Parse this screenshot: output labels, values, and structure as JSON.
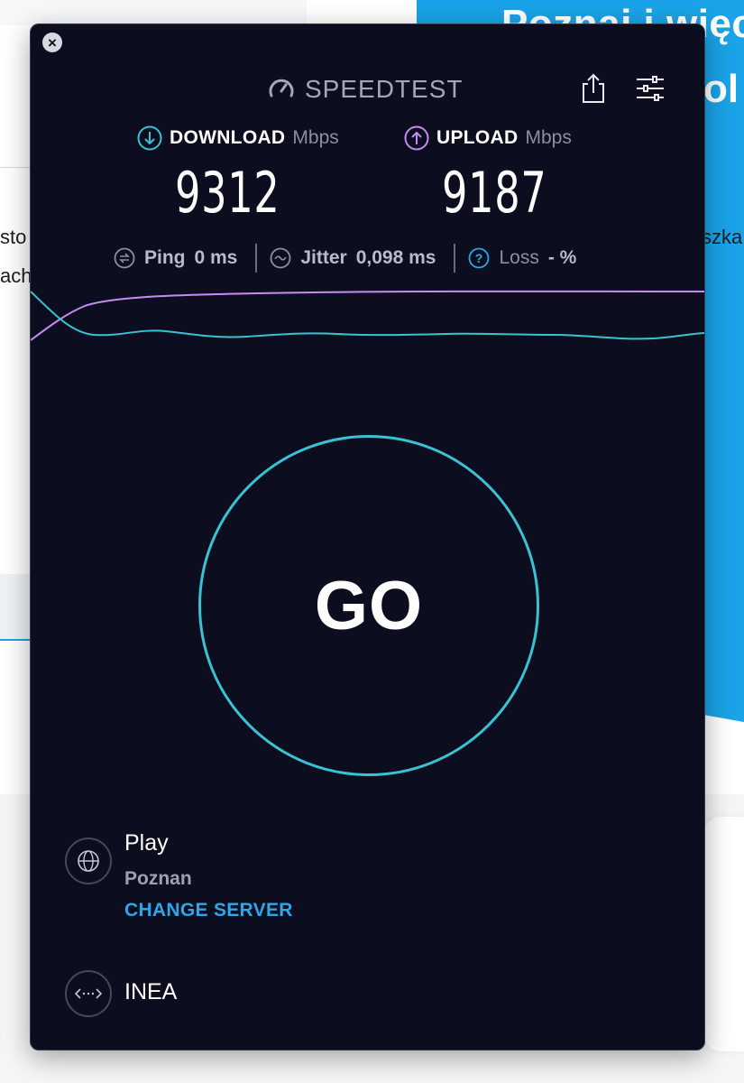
{
  "background_page": {
    "hero_title_line1": "Poznaj i więc",
    "hero_title_line2": "ol",
    "left_text_1": "sto",
    "left_text_2": "ach",
    "right_text_1": "szka",
    "accent_color": "#1aa3e8"
  },
  "window": {
    "close_icon": "close-icon",
    "brand": "SPEEDTEST",
    "share_icon": "share-icon",
    "settings_icon": "settings-sliders-icon"
  },
  "download": {
    "label": "DOWNLOAD",
    "unit": "Mbps",
    "value": "9312",
    "color": "#3ac2d2"
  },
  "upload": {
    "label": "UPLOAD",
    "unit": "Mbps",
    "value": "9187",
    "color": "#c48cf2"
  },
  "stats": {
    "ping_label": "Ping",
    "ping_value": "0 ms",
    "jitter_label": "Jitter",
    "jitter_value": "0,098 ms",
    "loss_label": "Loss",
    "loss_value": "- %"
  },
  "go_button": {
    "label": "GO",
    "ring_color": "#3ac2d2"
  },
  "server": {
    "name": "Play",
    "city": "Poznan",
    "change_label": "CHANGE SERVER",
    "isp": "INEA"
  }
}
